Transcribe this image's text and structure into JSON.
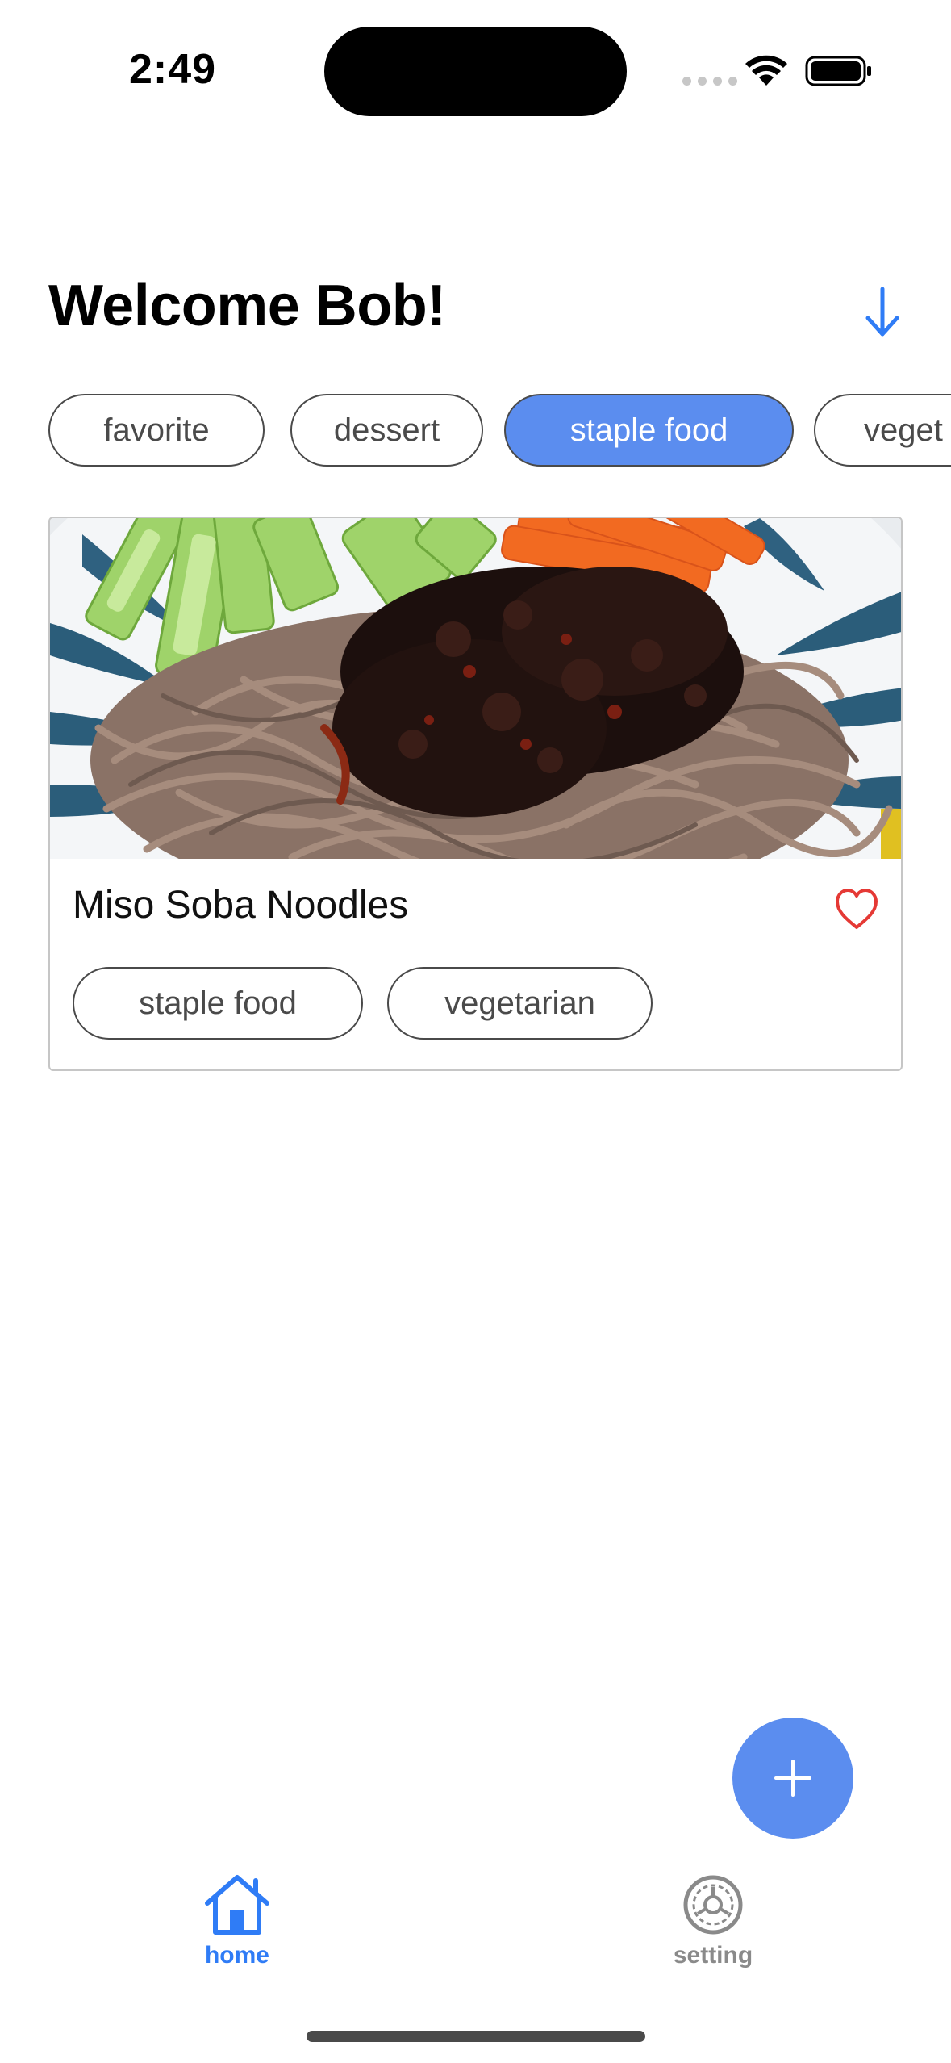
{
  "status_bar": {
    "time": "2:49"
  },
  "header": {
    "title": "Welcome Bob!",
    "sort_icon": "arrow-down-icon"
  },
  "filter_chips": [
    {
      "label": "favorite",
      "active": false
    },
    {
      "label": "dessert",
      "active": false
    },
    {
      "label": "staple food",
      "active": true
    },
    {
      "label": "veget",
      "active": false
    }
  ],
  "recipes": [
    {
      "title": "Miso Soba Noodles",
      "favorite_icon": "heart-outline-icon",
      "tags": [
        "staple food",
        "vegetarian"
      ]
    }
  ],
  "fab": {
    "icon": "plus-icon"
  },
  "tab_bar": {
    "home_label": "home",
    "setting_label": "setting"
  },
  "colors": {
    "accent": "#5b8def",
    "tab_active": "#2f7cf6",
    "tab_inactive": "#8a8a8a",
    "favorite": "#e53935"
  }
}
